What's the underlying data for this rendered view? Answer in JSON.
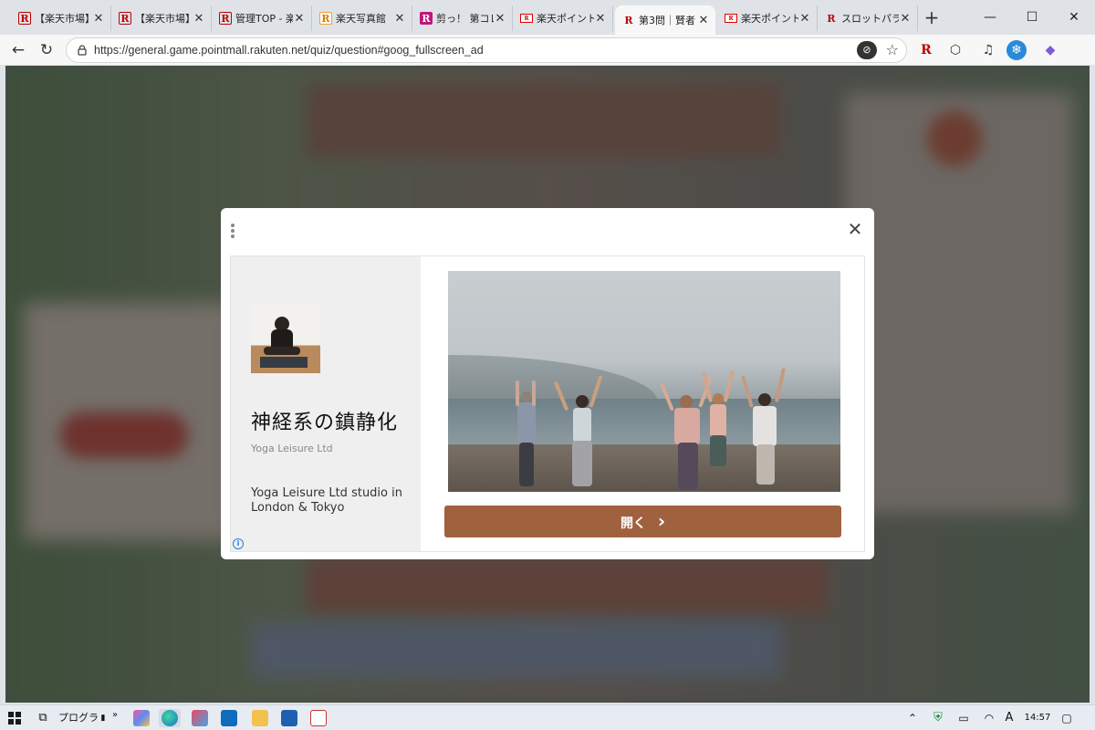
{
  "browser": {
    "tabs": [
      {
        "title": "【楽天市場】S",
        "favicon": "rakuten-r-icon",
        "active": false
      },
      {
        "title": "【楽天市場】",
        "favicon": "rakuten-r-icon",
        "active": false
      },
      {
        "title": "管理TOP - 楽",
        "favicon": "rakuten-r-icon",
        "active": false
      },
      {
        "title": "楽天写真館",
        "favicon": "rakuten-photo-icon",
        "active": false
      },
      {
        "title": "剪っ！ 第コレ",
        "favicon": "rakuten-pink-icon",
        "active": false
      },
      {
        "title": "楽天ポイント",
        "favicon": "rakuten-point-icon",
        "active": false
      },
      {
        "title": "第3問｜賢者",
        "favicon": "rakuten-r-icon",
        "active": true
      },
      {
        "title": "楽天ポイント",
        "favicon": "rakuten-point-icon",
        "active": false
      },
      {
        "title": "スロットパラダ",
        "favicon": "rakuten-r-icon",
        "active": false
      }
    ],
    "url": "https://general.game.pointmall.rakuten.net/quiz/question#goog_fullscreen_ad",
    "icons": {
      "back": "←",
      "reload": "↻",
      "newtab": "+",
      "minimize": "—",
      "maximize": "☐",
      "close": "✕",
      "star": "☆",
      "eye": "⊘",
      "rakuten": "R",
      "extensions": "⬡",
      "media": "♫",
      "profile": "❄",
      "copilot": "◆"
    }
  },
  "ad": {
    "title": "神経系の鎮静化",
    "brand": "Yoga Leisure Ltd",
    "description": "Yoga Leisure Ltd studio in London & Tokyo",
    "cta_label": "開く",
    "cta_chevron": "›",
    "close_glyph": "✕",
    "info_glyph": "i",
    "accent_color": "#a0613f"
  },
  "taskbar": {
    "program_label": "プログラム",
    "chevron": "»",
    "time": "14:57",
    "ime_label": "A"
  }
}
